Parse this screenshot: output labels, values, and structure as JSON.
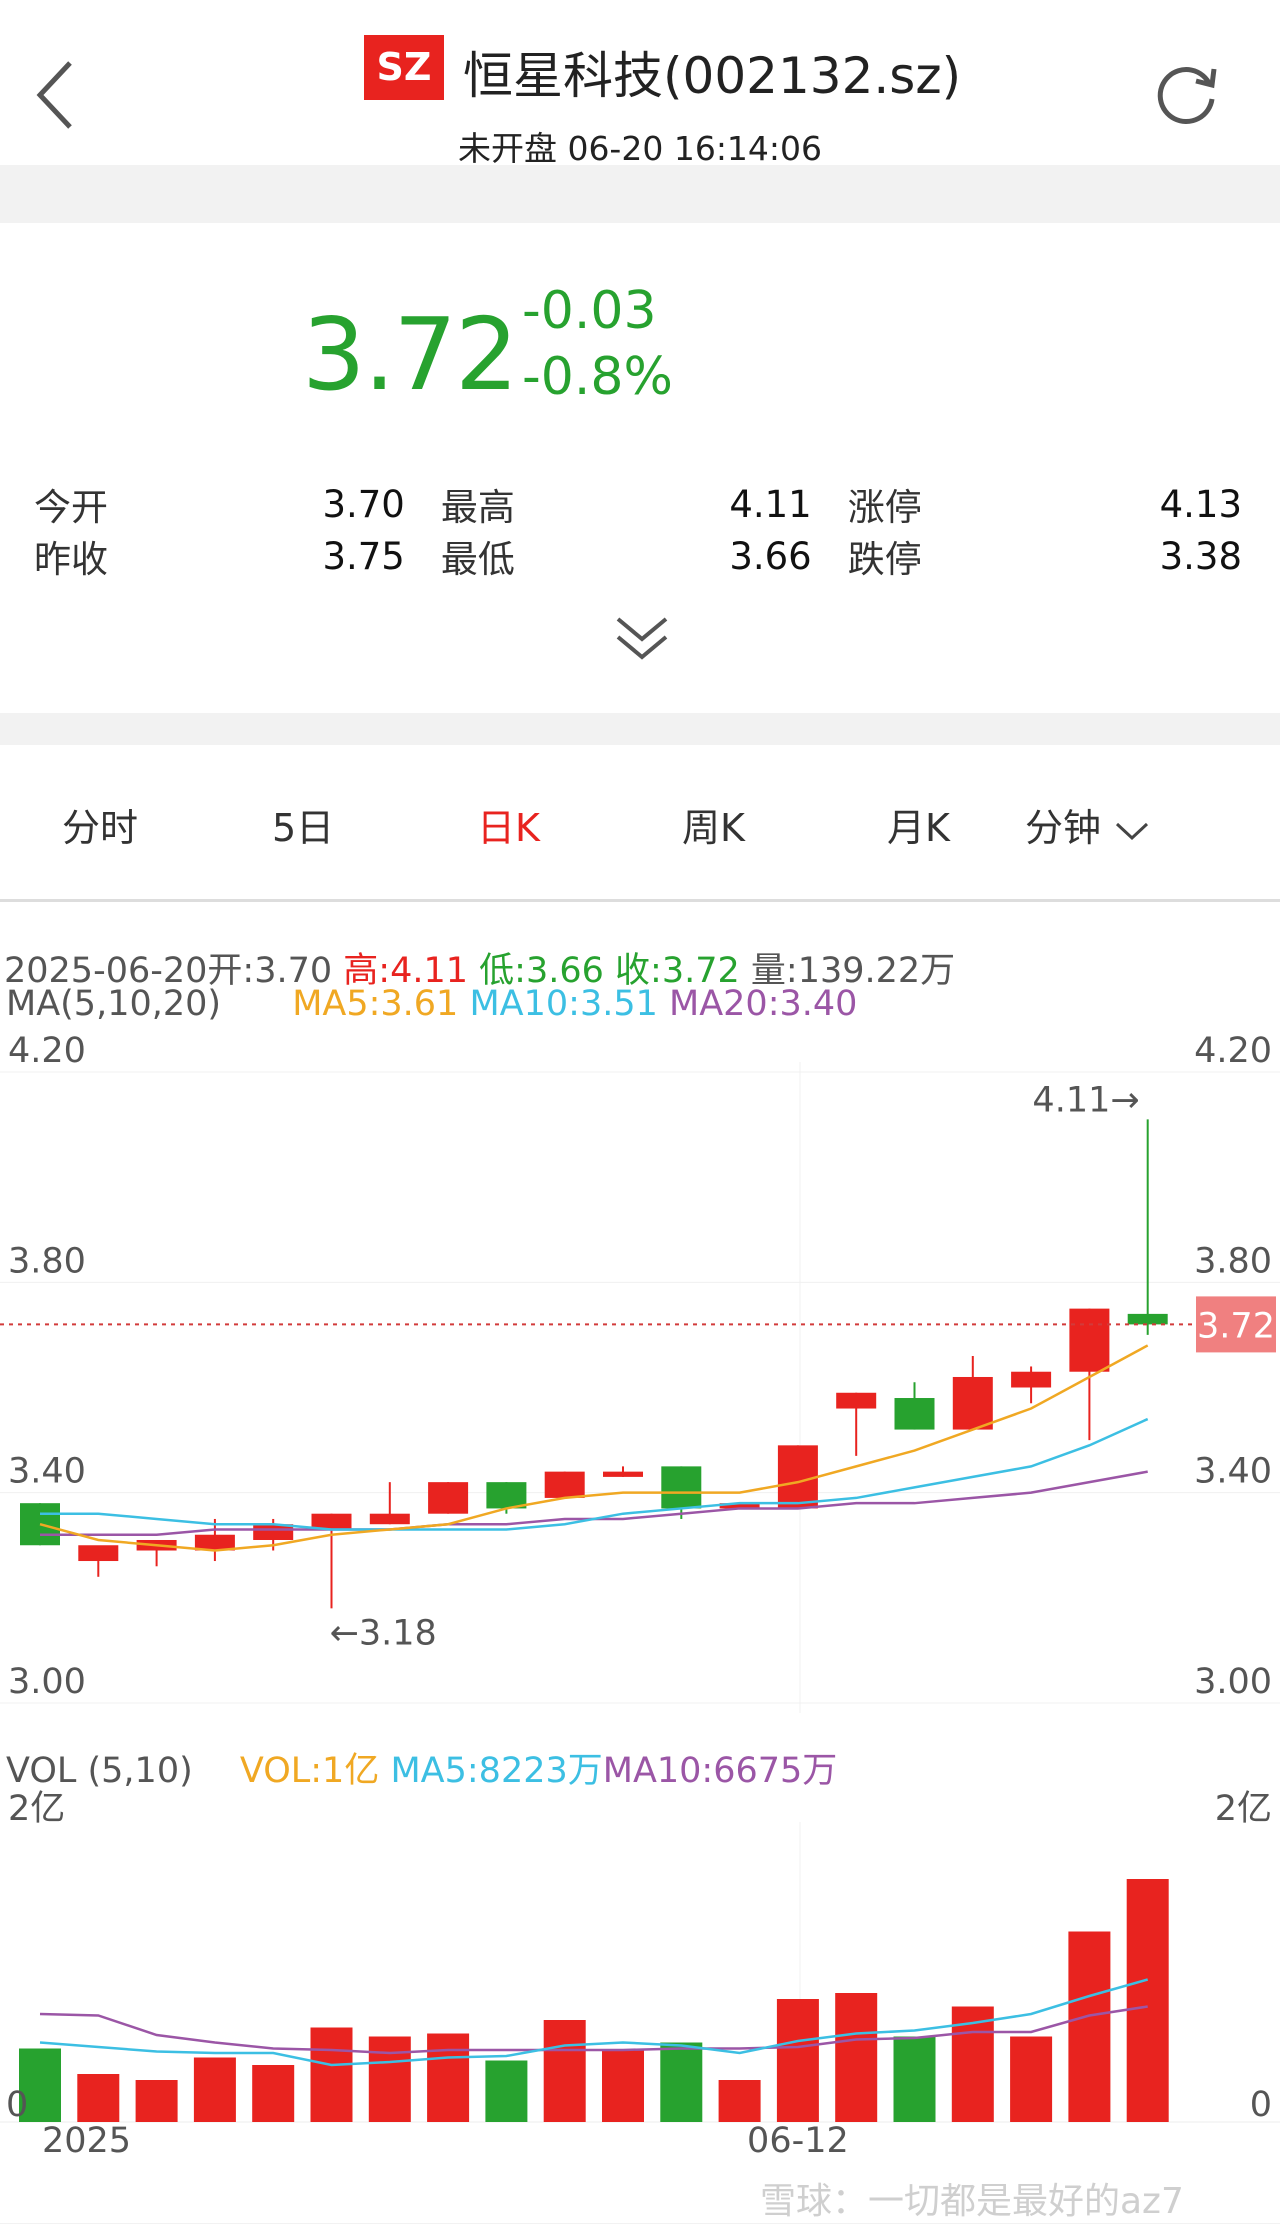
{
  "header": {
    "exchange": "SZ",
    "title": "恒星科技(002132.sz)",
    "status_time": "未开盘 06-20 16:14:06",
    "icons": {
      "back": "chevron-left-icon",
      "refresh": "refresh-icon"
    }
  },
  "quote": {
    "price": "3.72",
    "change": "-0.03",
    "change_pct": "-0.8%",
    "rows": [
      [
        {
          "label": "今开",
          "value": "3.70"
        },
        {
          "label": "最高",
          "value": "4.11"
        },
        {
          "label": "涨停",
          "value": "4.13"
        }
      ],
      [
        {
          "label": "昨收",
          "value": "3.75"
        },
        {
          "label": "最低",
          "value": "3.66"
        },
        {
          "label": "跌停",
          "value": "3.38"
        }
      ]
    ]
  },
  "tabs": [
    "分时",
    "5日",
    "日K",
    "周K",
    "月K",
    "分钟"
  ],
  "active_tab": "日K",
  "ohlc_bar": {
    "date_open": "2025-06-20开:3.70",
    "high": "高:4.11",
    "low": "低:3.66",
    "close": "收:3.72",
    "volume": "量:139.22万"
  },
  "ma_legend": {
    "label": "MA(5,10,20)",
    "ma5": "MA5:3.61",
    "ma10": "MA10:3.51",
    "ma20": "MA20:3.40"
  },
  "vol_legend": {
    "label": "VOL (5,10)",
    "vol": "VOL:1亿",
    "ma5": "MA5:8223万",
    "ma10": "MA10:6675万"
  },
  "watermark": "雪球：一切都是最好的az7",
  "colors": {
    "up": "#e8231f",
    "down": "#27a22f",
    "ma5": "#f0a823",
    "ma10": "#3cbfe3",
    "ma20": "#9b56a6"
  },
  "chart_data": {
    "type": "candlestick",
    "price_axis": {
      "ylim": [
        3.0,
        4.2
      ],
      "ticks": [
        "4.20",
        "3.80",
        "3.40",
        "3.00"
      ]
    },
    "x_labels": [
      {
        "index": 0,
        "text": "2025"
      },
      {
        "index": 13,
        "text": "06-12"
      }
    ],
    "current_price": {
      "value": 3.72,
      "label": "3.72"
    },
    "annotations": {
      "max": {
        "index": 19,
        "value": 4.11,
        "text": "4.11→"
      },
      "min": {
        "index": 5,
        "value": 3.18,
        "text": "←3.18"
      }
    },
    "candles": [
      {
        "o": 3.38,
        "h": 3.38,
        "l": 3.3,
        "c": 3.3
      },
      {
        "o": 3.27,
        "h": 3.27,
        "l": 3.24,
        "c": 3.3
      },
      {
        "o": 3.29,
        "h": 3.31,
        "l": 3.26,
        "c": 3.31
      },
      {
        "o": 3.29,
        "h": 3.35,
        "l": 3.27,
        "c": 3.32
      },
      {
        "o": 3.31,
        "h": 3.35,
        "l": 3.29,
        "c": 3.34
      },
      {
        "o": 3.33,
        "h": 3.36,
        "l": 3.18,
        "c": 3.36
      },
      {
        "o": 3.34,
        "h": 3.42,
        "l": 3.34,
        "c": 3.36
      },
      {
        "o": 3.36,
        "h": 3.42,
        "l": 3.36,
        "c": 3.42
      },
      {
        "o": 3.42,
        "h": 3.42,
        "l": 3.36,
        "c": 3.37
      },
      {
        "o": 3.39,
        "h": 3.44,
        "l": 3.39,
        "c": 3.44
      },
      {
        "o": 3.43,
        "h": 3.45,
        "l": 3.43,
        "c": 3.44
      },
      {
        "o": 3.45,
        "h": 3.45,
        "l": 3.35,
        "c": 3.37
      },
      {
        "o": 3.37,
        "h": 3.38,
        "l": 3.37,
        "c": 3.38
      },
      {
        "o": 3.37,
        "h": 3.49,
        "l": 3.37,
        "c": 3.49
      },
      {
        "o": 3.56,
        "h": 3.59,
        "l": 3.47,
        "c": 3.59
      },
      {
        "o": 3.58,
        "h": 3.61,
        "l": 3.52,
        "c": 3.52
      },
      {
        "o": 3.52,
        "h": 3.66,
        "l": 3.52,
        "c": 3.62
      },
      {
        "o": 3.6,
        "h": 3.64,
        "l": 3.57,
        "c": 3.63
      },
      {
        "o": 3.63,
        "h": 3.75,
        "l": 3.5,
        "c": 3.75
      },
      {
        "o": 3.74,
        "h": 4.11,
        "l": 3.7,
        "c": 3.72
      }
    ],
    "ma5": [
      3.34,
      3.31,
      3.3,
      3.29,
      3.3,
      3.32,
      3.33,
      3.34,
      3.37,
      3.39,
      3.4,
      3.4,
      3.4,
      3.42,
      3.45,
      3.48,
      3.52,
      3.56,
      3.62,
      3.68
    ],
    "ma10": [
      3.36,
      3.36,
      3.35,
      3.34,
      3.34,
      3.33,
      3.33,
      3.33,
      3.33,
      3.34,
      3.36,
      3.37,
      3.38,
      3.38,
      3.39,
      3.41,
      3.43,
      3.45,
      3.49,
      3.54
    ],
    "ma20": [
      3.32,
      3.32,
      3.32,
      3.33,
      3.33,
      3.33,
      3.33,
      3.34,
      3.34,
      3.35,
      3.35,
      3.36,
      3.37,
      3.37,
      3.38,
      3.38,
      3.39,
      3.4,
      3.42,
      3.44
    ],
    "volume": {
      "ylim": [
        0,
        2.0
      ],
      "unit": "亿",
      "ticks": [
        "2亿",
        "0"
      ],
      "values": [
        0.49,
        0.32,
        0.28,
        0.43,
        0.38,
        0.63,
        0.57,
        0.59,
        0.41,
        0.68,
        0.48,
        0.53,
        0.28,
        0.82,
        0.86,
        0.57,
        0.77,
        0.57,
        1.27,
        1.62
      ],
      "dir": [
        "d",
        "u",
        "u",
        "u",
        "u",
        "u",
        "u",
        "u",
        "d",
        "u",
        "u",
        "d",
        "u",
        "u",
        "u",
        "d",
        "u",
        "u",
        "u",
        "u"
      ],
      "ma5": [
        0.53,
        0.5,
        0.47,
        0.46,
        0.46,
        0.38,
        0.4,
        0.43,
        0.44,
        0.51,
        0.53,
        0.51,
        0.46,
        0.54,
        0.59,
        0.61,
        0.66,
        0.72,
        0.84,
        0.95
      ],
      "ma10": [
        0.72,
        0.71,
        0.58,
        0.53,
        0.49,
        0.48,
        0.46,
        0.48,
        0.48,
        0.48,
        0.48,
        0.49,
        0.49,
        0.5,
        0.55,
        0.56,
        0.6,
        0.6,
        0.71,
        0.77
      ]
    }
  }
}
